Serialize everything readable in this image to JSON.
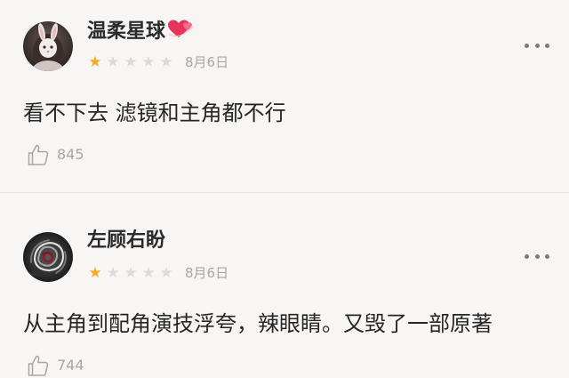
{
  "reviews": [
    {
      "username": "温柔星球",
      "username_emoji": "💞",
      "rating": 1,
      "stars_total": 5,
      "date": "8月6日",
      "content": "看不下去 滤镜和主角都不行",
      "likes": "845",
      "avatar_icon": "bunny-girl-avatar",
      "more_icon": "more-dots-icon",
      "like_icon": "thumbs-up-icon"
    },
    {
      "username": "左顾右盼",
      "rating": 1,
      "stars_total": 5,
      "date": "8月6日",
      "content": "从主角到配角演技浮夸，辣眼睛。又毁了一部原著",
      "likes": "744",
      "avatar_icon": "dark-rose-avatar",
      "more_icon": "more-dots-icon",
      "like_icon": "thumbs-up-icon"
    }
  ],
  "colors": {
    "background": "#f8f6f4",
    "star_filled": "#f2ac2d",
    "star_empty": "#dedad7",
    "meta_text": "#a9a6a4",
    "divider": "#e6e1de"
  }
}
